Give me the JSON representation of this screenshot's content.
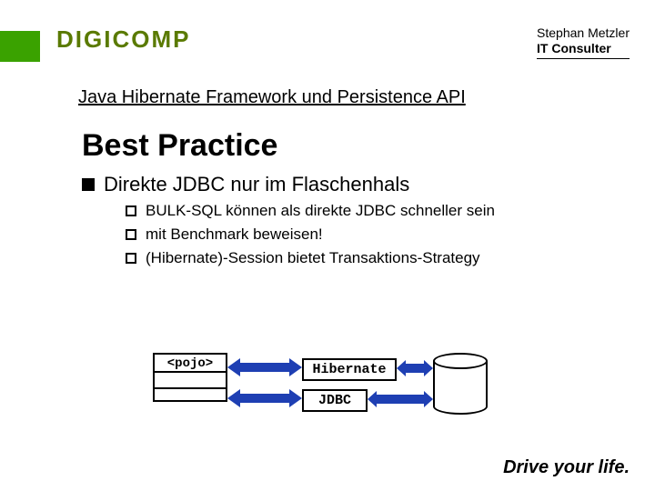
{
  "header": {
    "logo_text": "DIGICOMP",
    "author_name": "Stephan Metzler",
    "author_role": "IT Consulter"
  },
  "subtitle": "Java Hibernate Framework und Persistence API",
  "title": "Best Practice",
  "bullet_main": "Direkte JDBC nur im Flaschenhals",
  "sub_bullets": [
    "BULK-SQL können als direkte JDBC schneller sein",
    "mit Benchmark beweisen!",
    "(Hibernate)-Session bietet Transaktions-Strategy"
  ],
  "diagram": {
    "pojo_label": "<pojo>",
    "hibernate_label": "Hibernate",
    "jdbc_label": "JDBC"
  },
  "slogan": "Drive your life.",
  "colors": {
    "accent_green": "#3aa200",
    "arrow_blue": "#1e3fb3"
  }
}
